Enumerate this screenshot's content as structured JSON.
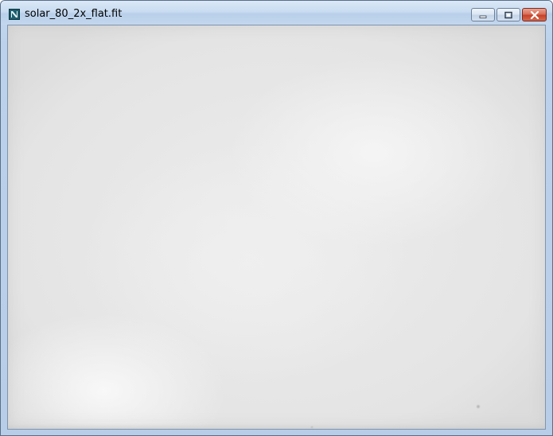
{
  "window": {
    "title": "solar_80_2x_flat.fit"
  },
  "caption_buttons": {
    "minimize": "minimize",
    "maximize": "maximize",
    "close": "close"
  },
  "icons": {
    "app": "app-icon",
    "minimize": "minimize-icon",
    "maximize": "maximize-icon",
    "close": "close-icon"
  },
  "colors": {
    "titlebar": "#c9dcf1",
    "close_button": "#c7432b",
    "image_background": "#e8e8e8"
  }
}
